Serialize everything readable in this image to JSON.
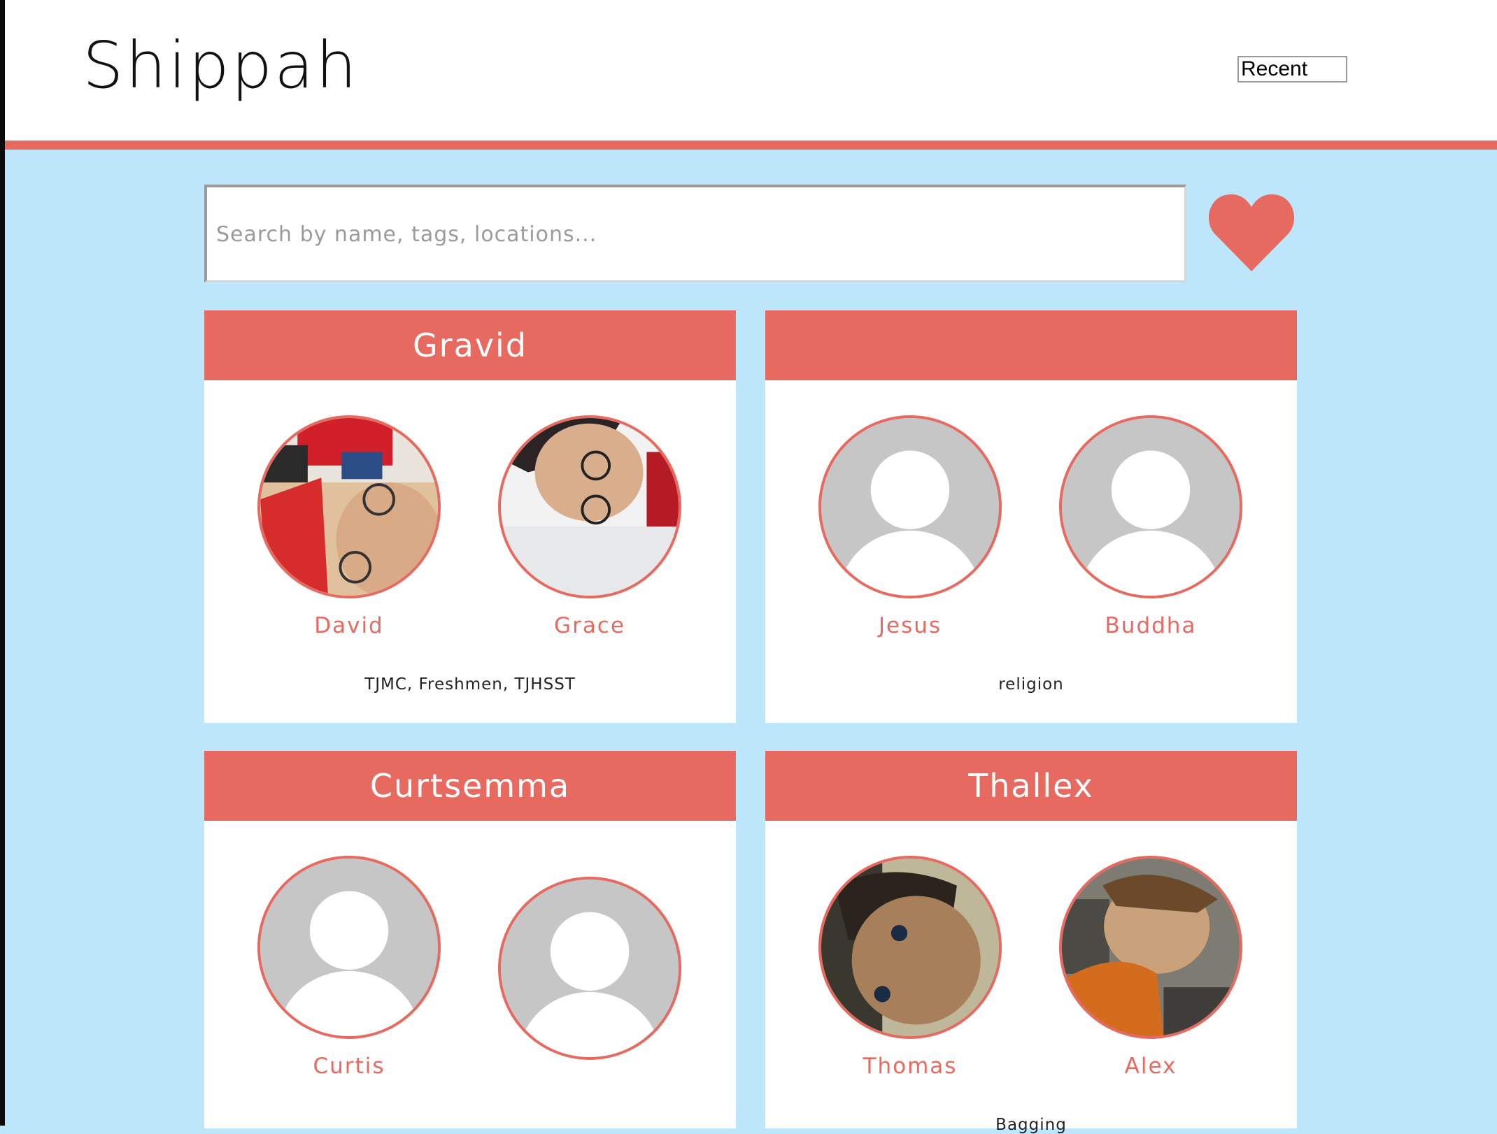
{
  "app": {
    "title": "Shippah"
  },
  "sort": {
    "selected": "Recent"
  },
  "search": {
    "placeholder": "Search by name, tags, locations..."
  },
  "colors": {
    "accent": "#e76a60",
    "background": "#bde6fb",
    "placeholder_avatar": "#c6c6c6"
  },
  "ships": [
    {
      "title": "Gravid",
      "members": [
        {
          "name": "David",
          "avatar": "photo"
        },
        {
          "name": "Grace",
          "avatar": "photo"
        }
      ],
      "tags": "TJMC, Freshmen, TJHSST"
    },
    {
      "title": "",
      "members": [
        {
          "name": "Jesus",
          "avatar": "default-user-icon"
        },
        {
          "name": "Buddha",
          "avatar": "default-user-icon"
        }
      ],
      "tags": "religion"
    },
    {
      "title": "Curtsemma",
      "members": [
        {
          "name": "Curtis",
          "avatar": "default-user-icon"
        },
        {
          "name": "",
          "avatar": "default-user-icon"
        }
      ],
      "tags": ""
    },
    {
      "title": "Thallex",
      "members": [
        {
          "name": "Thomas",
          "avatar": "photo"
        },
        {
          "name": "Alex",
          "avatar": "photo"
        }
      ],
      "tags": "Bagging"
    }
  ]
}
